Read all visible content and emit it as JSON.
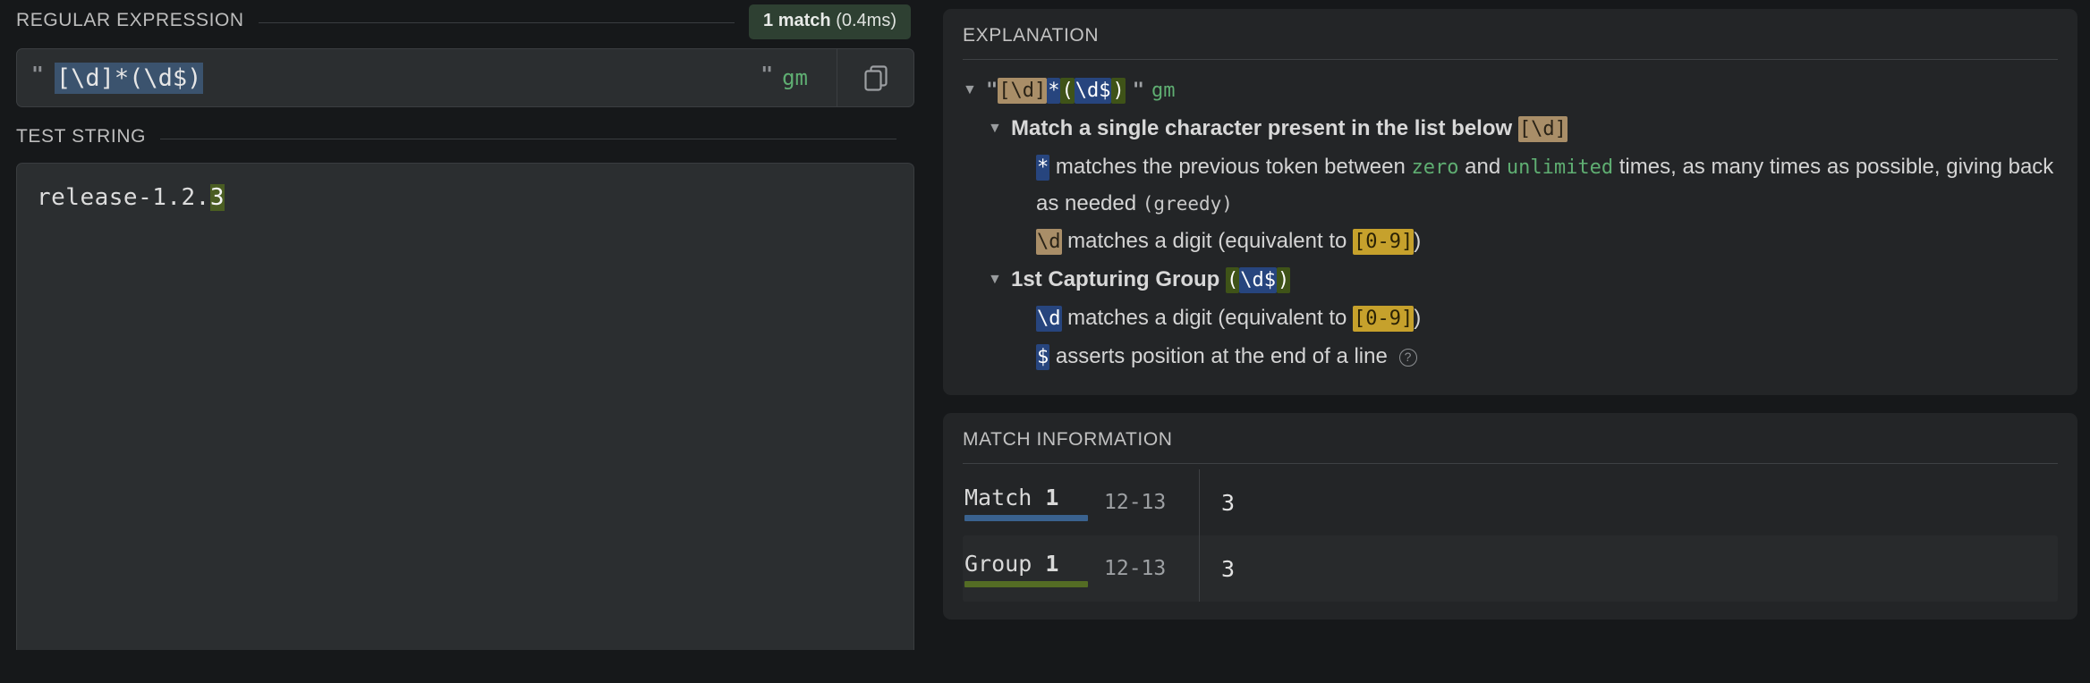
{
  "left": {
    "regular_expression": {
      "title": "REGULAR EXPRESSION",
      "badge_count": "1 match",
      "badge_time": "(0.4ms)",
      "badge_color": "#2e4032",
      "quote_open": "\"",
      "pattern": "[\\d]*(\\d$)",
      "quote_close": "\"",
      "flags": "gm",
      "copy_icon": "copy-icon"
    },
    "test_string": {
      "title": "TEST STRING",
      "prefix": "release-1.2.",
      "match_text": "3",
      "match_highlight_color": "#4a5d22"
    }
  },
  "right": {
    "explanation": {
      "title": "EXPLANATION",
      "root": {
        "caret": "▼",
        "quote_open": "\"",
        "tokens": [
          {
            "text": "[\\d]",
            "style": "tan"
          },
          {
            "text": "*",
            "style": "blue"
          },
          {
            "text": "(",
            "style": "green"
          },
          {
            "text": "\\d$",
            "style": "blue"
          },
          {
            "text": ")",
            "style": "green"
          }
        ],
        "quote_close": "\"",
        "flags": "gm"
      },
      "nodes": [
        {
          "caret": "▼",
          "level": 2,
          "heading": "Match a single character present in the list below",
          "heading_token": "[\\d]",
          "heading_token_style": "tan"
        },
        {
          "caret": "",
          "level": 3,
          "token": "*",
          "token_style": "blue",
          "text_a": "matches the previous token between",
          "green_a": "zero",
          "text_b": "and",
          "green_b": "unlimited",
          "text_c": "times, as many times as possible, giving back as needed",
          "grey": "(greedy)"
        },
        {
          "caret": "",
          "level": 3,
          "token": "\\d",
          "token_style": "tan",
          "text_a": "matches a digit (equivalent to",
          "token_b": "[0-9]",
          "token_b_style": "gold",
          "text_b": ")"
        },
        {
          "caret": "▼",
          "level": 2,
          "heading": "1st Capturing Group",
          "heading_tokens": [
            {
              "text": "(",
              "style": "green"
            },
            {
              "text": "\\d$",
              "style": "blue"
            },
            {
              "text": ")",
              "style": "green"
            }
          ]
        },
        {
          "caret": "",
          "level": 3,
          "token": "\\d",
          "token_style": "blue",
          "text_a": "matches a digit (equivalent to",
          "token_b": "[0-9]",
          "token_b_style": "gold",
          "text_b": ")"
        },
        {
          "caret": "",
          "level": 3,
          "token": "$",
          "token_style": "blue",
          "text_a": "asserts position at the end of a line",
          "help_icon": "help-icon"
        }
      ]
    },
    "match_information": {
      "title": "MATCH INFORMATION",
      "rows": [
        {
          "label": "Match",
          "index": "1",
          "range": "12-13",
          "value": "3",
          "underline_color": "#3a628f"
        },
        {
          "label": "Group",
          "index": "1",
          "range": "12-13",
          "value": "3",
          "underline_color": "#546c24"
        }
      ]
    }
  }
}
